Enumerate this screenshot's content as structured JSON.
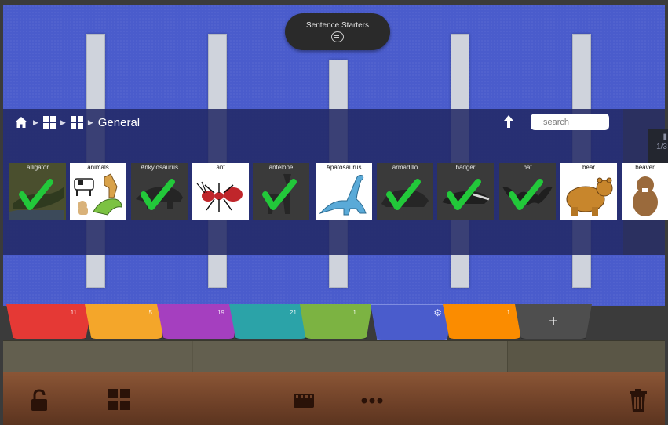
{
  "top": {
    "sentence_starters_label": "Sentence Starters",
    "icon": "speech-bubble-icon"
  },
  "breadcrumb": {
    "items": [
      "home-icon",
      "grid-icon",
      "grid-icon"
    ],
    "current": "General"
  },
  "search": {
    "placeholder": "search"
  },
  "navigation": {
    "up_icon": "up-arrow-icon"
  },
  "tiles": [
    {
      "label": "alligator",
      "style": "dark",
      "checked": true,
      "icon": "alligator-icon"
    },
    {
      "label": "animals",
      "style": "light",
      "checked": false,
      "icon": "animals-icon"
    },
    {
      "label": "Ankylosaurus",
      "style": "dark",
      "checked": true,
      "icon": "ankylosaurus-icon"
    },
    {
      "label": "ant",
      "style": "light",
      "checked": false,
      "icon": "ant-icon"
    },
    {
      "label": "antelope",
      "style": "dark",
      "checked": true,
      "icon": "antelope-icon"
    },
    {
      "label": "Apatosaurus",
      "style": "light",
      "checked": false,
      "icon": "apatosaurus-icon"
    },
    {
      "label": "armadillo",
      "style": "dark",
      "checked": true,
      "icon": "armadillo-icon"
    },
    {
      "label": "badger",
      "style": "dark",
      "checked": true,
      "icon": "badger-icon"
    },
    {
      "label": "bat",
      "style": "dark",
      "checked": true,
      "icon": "bat-icon"
    },
    {
      "label": "bear",
      "style": "light",
      "checked": false,
      "icon": "bear-icon"
    },
    {
      "label": "beaver",
      "style": "light",
      "checked": false,
      "icon": "beaver-icon"
    }
  ],
  "side_panel": {
    "page_indicator": "1/3"
  },
  "tabs": [
    {
      "color": "#e53935",
      "count": "11"
    },
    {
      "color": "#f4a62a",
      "count": "5"
    },
    {
      "color": "#a53fbf",
      "count": "19"
    },
    {
      "color": "#2ba3a8",
      "count": "21"
    },
    {
      "color": "#7cb342",
      "count": "1"
    },
    {
      "color": "#4a5ccc",
      "count": "",
      "icon": "gear-icon"
    },
    {
      "color": "#fb8c00",
      "count": "1"
    },
    {
      "color": "#4e4e4e",
      "count": "+",
      "icon": "plus-icon"
    }
  ],
  "toolbar": {
    "buttons": [
      "lock-open-icon",
      "grid-icon",
      "film-icon",
      "more-icon",
      "trash-icon"
    ]
  },
  "colors": {
    "canvas": "#4a5ccc",
    "band": "#222864",
    "check": "#2ecc40",
    "toolbar": "#6f4128"
  }
}
